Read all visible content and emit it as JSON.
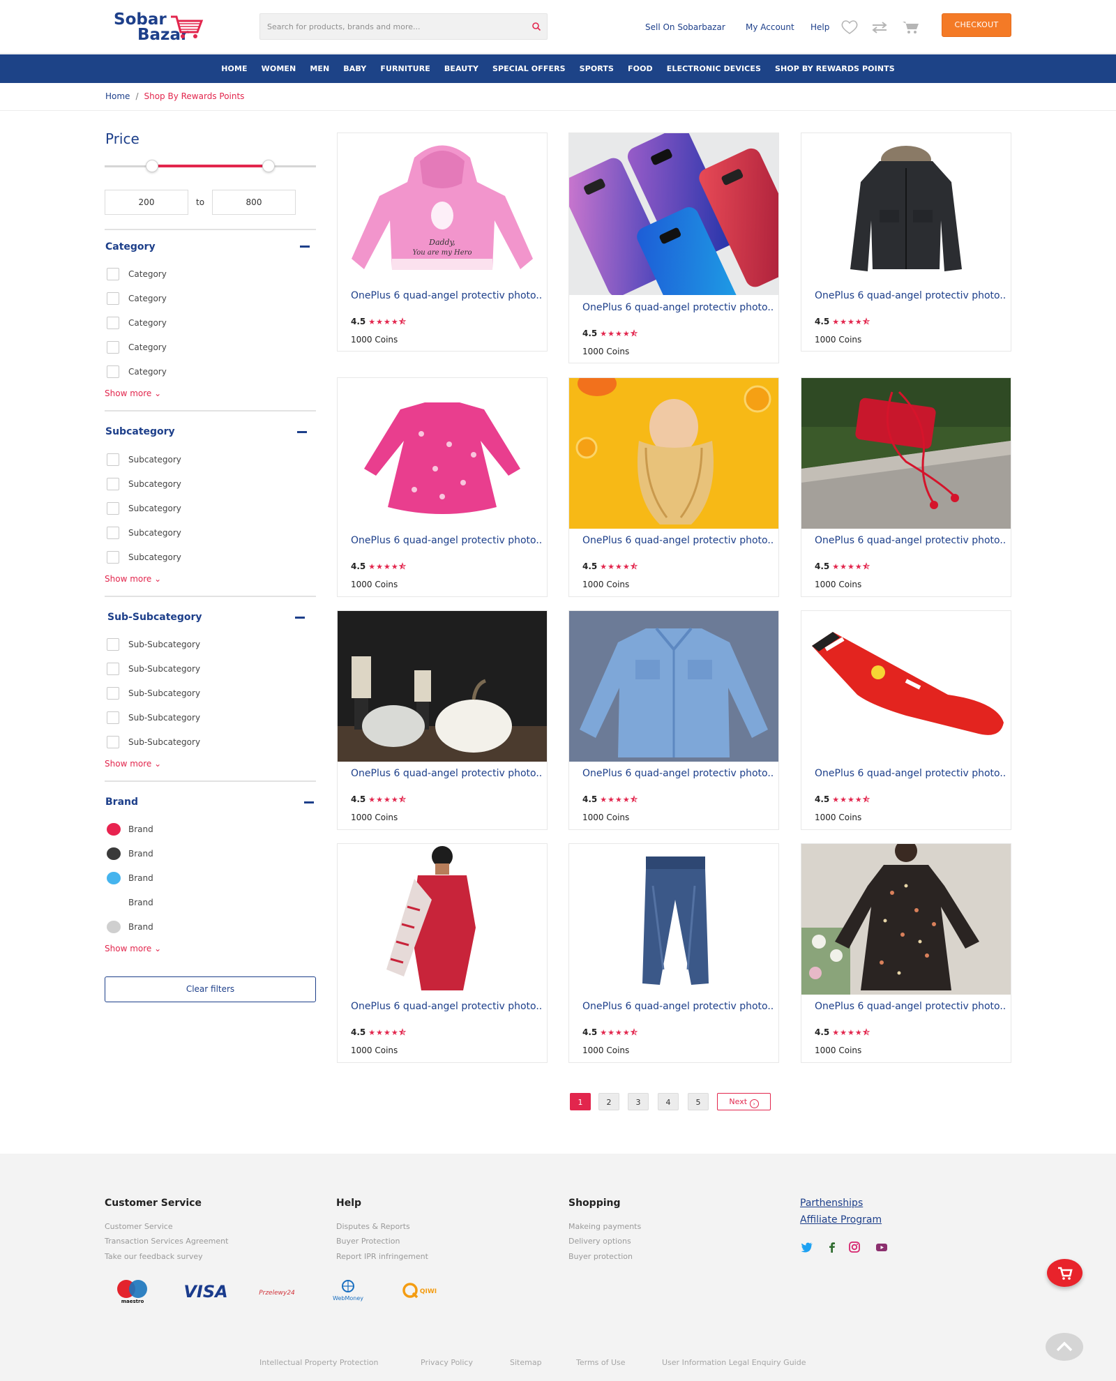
{
  "header": {
    "logo_line1": "Sobar",
    "logo_line2": "Bazar",
    "search_placeholder": "Search for products, brands and more...",
    "links": [
      "Sell On Sobarbazar",
      "My Account",
      "Help"
    ],
    "checkout_label": "CHECKOUT",
    "accent": "#f47a26"
  },
  "nav": {
    "items": [
      "HOME",
      "WOMEN",
      "MEN",
      "BABY",
      "FURNITURE",
      "BEAUTY",
      "SPECIAL OFFERS",
      "SPORTS",
      "FOOD",
      "ELECTRONIC DEVICES",
      "SHOP BY REWARDS POINTS"
    ],
    "background": "#1d4387"
  },
  "breadcrumb": {
    "home": "Home",
    "separator": "/",
    "current": "Shop By Rewards Points"
  },
  "filters": {
    "price": {
      "title": "Price",
      "min": "200",
      "to_label": "to",
      "max": "800"
    },
    "groups": [
      {
        "title": "Category",
        "items": [
          "Category",
          "Category",
          "Category",
          "Category",
          "Category"
        ]
      },
      {
        "title": "Subcategory",
        "items": [
          "Subcategory",
          "Subcategory",
          "Subcategory",
          "Subcategory",
          "Subcategory"
        ]
      },
      {
        "title": "Sub-Subcategory",
        "items": [
          "Sub-Subcategory",
          "Sub-Subcategory",
          "Sub-Subcategory",
          "Sub-Subcategory",
          "Sub-Subcategory"
        ]
      }
    ],
    "brand": {
      "title": "Brand",
      "items": [
        {
          "label": "Brand",
          "color": "#e8234f"
        },
        {
          "label": "Brand",
          "color": "#3a3a3a"
        },
        {
          "label": "Brand",
          "color": "#45b4ee"
        },
        {
          "label": "Brand",
          "color": "#ffffff"
        },
        {
          "label": "Brand",
          "color": "#cfcfcf"
        }
      ]
    },
    "show_more": "Show more",
    "clear_label": "Clear filters"
  },
  "products": [
    {
      "title": "OnePlus 6 quad-angel protectiv photo..",
      "rating": "4.5",
      "coins": "1000 Coins",
      "image": "pink-hoodie"
    },
    {
      "title": "OnePlus 6 quad-angel protectiv photo..",
      "rating": "4.5",
      "coins": "1000 Coins",
      "image": "phone-cases"
    },
    {
      "title": "OnePlus 6 quad-angel protectiv photo..",
      "rating": "4.5",
      "coins": "1000 Coins",
      "image": "black-parka"
    },
    {
      "title": "OnePlus 6 quad-angel protectiv photo..",
      "rating": "4.5",
      "coins": "1000 Coins",
      "image": "pink-dress"
    },
    {
      "title": "OnePlus 6 quad-angel protectiv photo..",
      "rating": "4.5",
      "coins": "1000 Coins",
      "image": "woman-hair"
    },
    {
      "title": "OnePlus 6 quad-angel protectiv photo..",
      "rating": "4.5",
      "coins": "1000 Coins",
      "image": "red-earphones"
    },
    {
      "title": "OnePlus 6 quad-angel protectiv photo..",
      "rating": "4.5",
      "coins": "1000 Coins",
      "image": "pumpkins"
    },
    {
      "title": "OnePlus 6 quad-angel protectiv photo..",
      "rating": "4.5",
      "coins": "1000 Coins",
      "image": "denim-shirt"
    },
    {
      "title": "OnePlus 6 quad-angel protectiv photo..",
      "rating": "4.5",
      "coins": "1000 Coins",
      "image": "red-sock"
    },
    {
      "title": "OnePlus 6 quad-angel protectiv photo..",
      "rating": "4.5",
      "coins": "1000 Coins",
      "image": "red-saree"
    },
    {
      "title": "OnePlus 6 quad-angel protectiv photo..",
      "rating": "4.5",
      "coins": "1000 Coins",
      "image": "jeans"
    },
    {
      "title": "OnePlus 6 quad-angel protectiv photo..",
      "rating": "4.5",
      "coins": "1000 Coins",
      "image": "floral-dress"
    }
  ],
  "rating_stars": "★★★★⯪",
  "pagination": {
    "pages": [
      "1",
      "2",
      "3",
      "4",
      "5"
    ],
    "active": "1",
    "next_label": "Next"
  },
  "footer": {
    "customer_service": {
      "title": "Customer Service",
      "links": [
        "Customer Service",
        "Transaction Services Agreement",
        "Take our feedback survey"
      ]
    },
    "help": {
      "title": "Help",
      "links": [
        "Disputes & Reports",
        "Buyer Protection",
        "Report IPR infringement"
      ]
    },
    "shopping": {
      "title": "Shopping",
      "links": [
        "Makeing payments",
        "Delivery options",
        "Buyer protection"
      ]
    },
    "partner_links": [
      "Parthenships",
      "Affiliate Program"
    ],
    "social": [
      "twitter-icon",
      "facebook-icon",
      "instagram-icon",
      "youtube-icon"
    ],
    "payments": {
      "maestro": "maestro",
      "visa": "VISA",
      "przelewy": "Przelewy24",
      "webmoney": "WebMoney",
      "qiwi": "QIWI"
    },
    "bottom_links": [
      "Intellectual Property Protection",
      "Privacy Policy",
      "Sitemap",
      "Terms of Use",
      "User Information Legal Enquiry Guide"
    ]
  }
}
